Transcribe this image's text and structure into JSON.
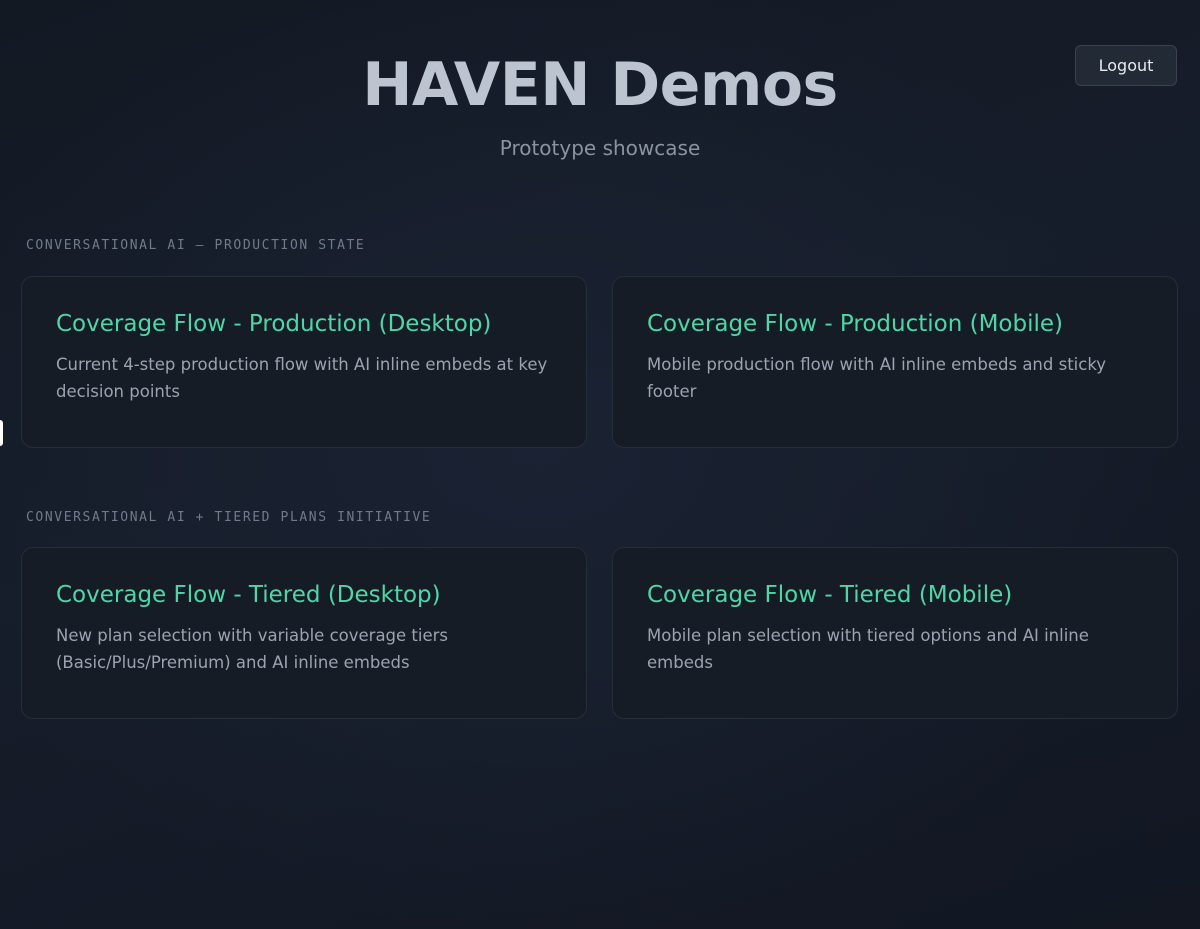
{
  "header": {
    "title": "HAVEN Demos",
    "subtitle": "Prototype showcase",
    "logout_label": "Logout"
  },
  "sections": [
    {
      "label": "CONVERSATIONAL AI — PRODUCTION STATE",
      "cards": [
        {
          "title": "Coverage Flow - Production (Desktop)",
          "description": "Current 4-step production flow with AI inline embeds at key decision points"
        },
        {
          "title": "Coverage Flow - Production (Mobile)",
          "description": "Mobile production flow with AI inline embeds and sticky footer"
        }
      ]
    },
    {
      "label": "CONVERSATIONAL AI + TIERED PLANS INITIATIVE",
      "cards": [
        {
          "title": "Coverage Flow - Tiered (Desktop)",
          "description": "New plan selection with variable coverage tiers (Basic/Plus/Premium) and AI inline embeds"
        },
        {
          "title": "Coverage Flow - Tiered (Mobile)",
          "description": "Mobile plan selection with tiered options and AI inline embeds"
        }
      ]
    }
  ],
  "colors": {
    "background": "#151b26",
    "card_title_accent": "#4fd6a7",
    "card_background": "#161c26",
    "title_text": "#bcc4d0"
  }
}
